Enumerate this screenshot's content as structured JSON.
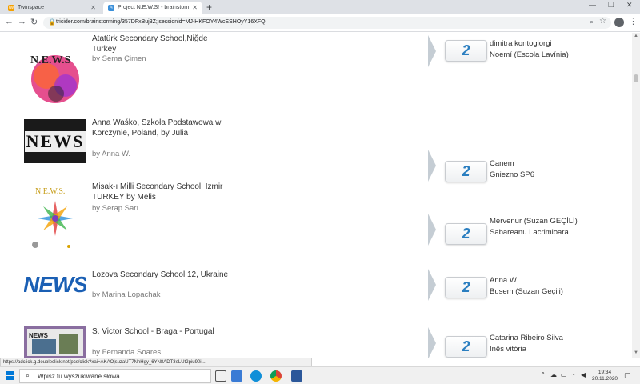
{
  "tabs": [
    {
      "label": "Twinspace",
      "favicon": "twinspace-icon"
    },
    {
      "label": "Project N.E.W.S! - brainstorming",
      "favicon": "tricider-icon"
    }
  ],
  "address_bar": {
    "url": "tricider.com/brainstorming/357DFxBuj3Z;jsessionid=MJ-HKFOY4WcESHOyY16XFQ"
  },
  "entries": [
    {
      "title": "Atatürk Secondary School,Niğde Turkey",
      "author": "by Sema Çimen",
      "count": "2",
      "voters": [
        "dimitra kontogiorgi",
        "Noemí (Escola Lavínia)"
      ]
    },
    {
      "title": "Anna Waśko, Szkoła Podstawowa w Korczynie, Poland, by Julia",
      "author": "by Anna W.",
      "count": "2",
      "voters": [
        "Canem",
        "Gniezno SP6"
      ]
    },
    {
      "title": "Misak-ı Milli Secondary School, İzmir TURKEY by Melis",
      "author": "by Serap Sarı",
      "count": "2",
      "voters": [
        "Mervenur (Suzan GEÇİLİ)",
        "Sabareanu Lacrimioara"
      ]
    },
    {
      "title": "Lozova Secondary School 12, Ukraine",
      "author": "by Marina Lopachak",
      "count": "2",
      "voters": [
        "Anna W.",
        "Busem (Suzan Geçili)"
      ]
    },
    {
      "title": "S. Victor School - Braga - Portugal",
      "author": "by Fernanda Soares",
      "count": "2",
      "voters": [
        "Catarina Ribeiro Silva",
        "Inês vitória"
      ]
    }
  ],
  "thumbnails": {
    "t1": "N.E.W.S",
    "t2": "NEWS",
    "t3": "N.E.W.S.",
    "t4": "NEWS",
    "t5": "NEWS"
  },
  "status_url": "https://adclick.g.doubleclick.net/pcs/click?xai=AKAOjsuzaUT7NnHgy_6YN8ADT3eLUt2piu90i...",
  "taskbar": {
    "search_placeholder": "Wpisz tu wyszukiwane słowa",
    "time": "19:34",
    "date": "20.11.2020"
  },
  "colors": {
    "count_text": "#2a7ec0",
    "tab_strip": "#dee1e6"
  }
}
